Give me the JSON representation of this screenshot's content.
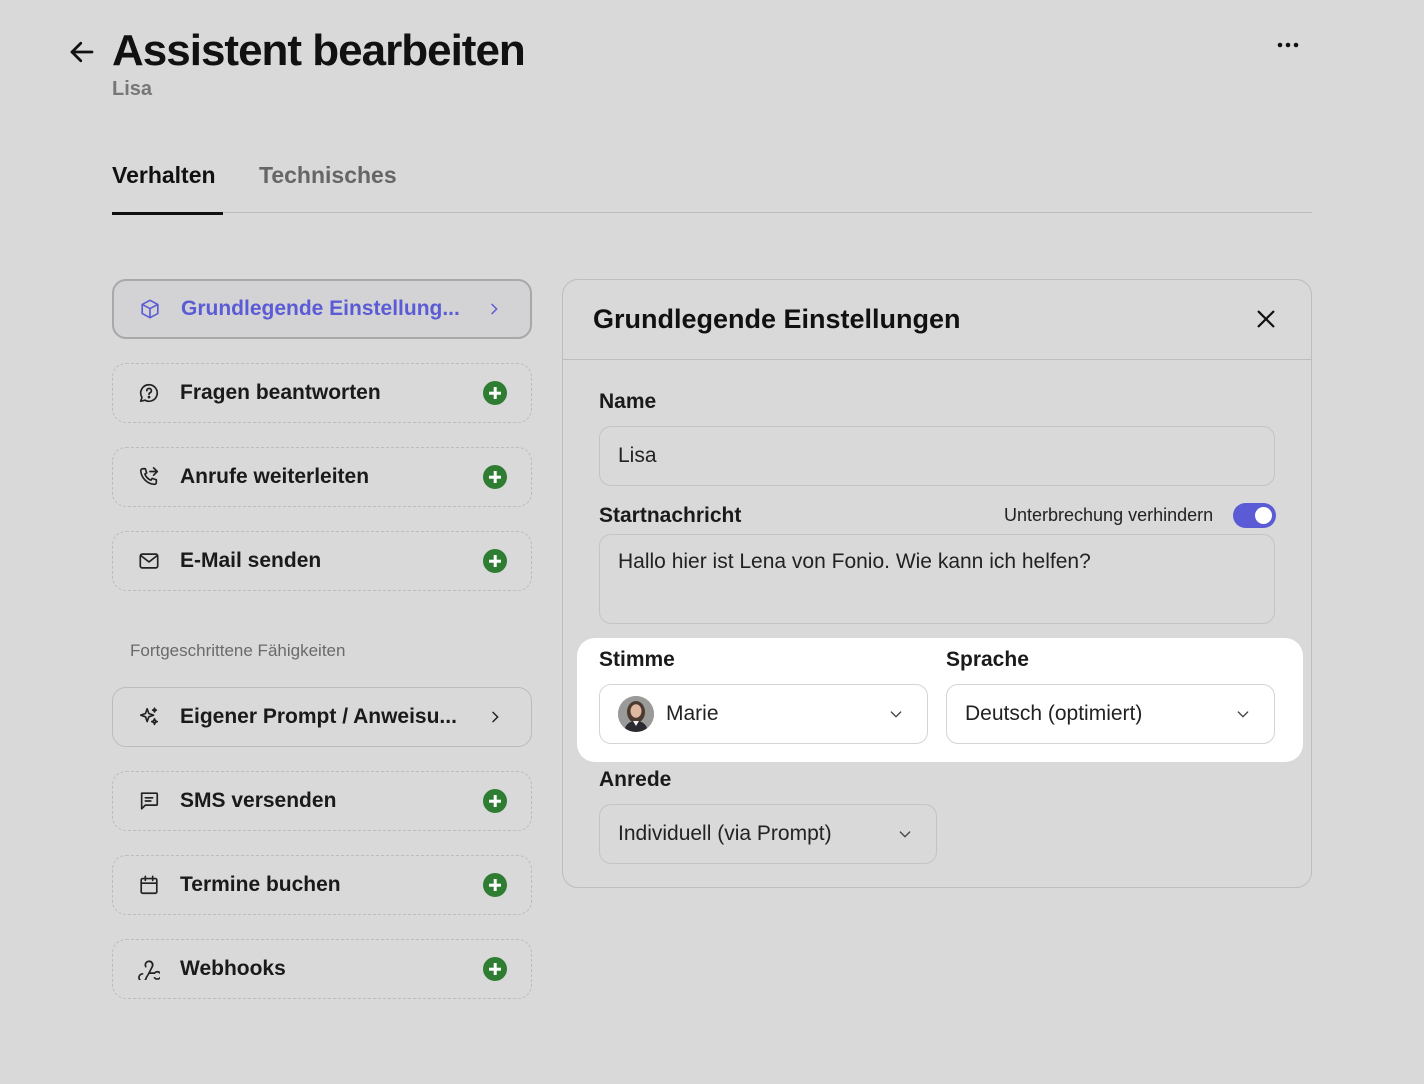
{
  "header": {
    "title": "Assistent bearbeiten",
    "subtitle": "Lisa",
    "back_icon": "arrow-left-icon",
    "more_icon": "more-horizontal-icon"
  },
  "tabs": [
    {
      "label": "Verhalten",
      "active": true
    },
    {
      "label": "Technisches",
      "active": false
    }
  ],
  "capabilities": {
    "basic": [
      {
        "label": "Grundlegende Einstellung...",
        "icon": "cube-icon",
        "action": "chevron-right-icon",
        "selected": true
      },
      {
        "label": "Fragen beantworten",
        "icon": "message-question-icon",
        "action": "plus-circle-icon"
      },
      {
        "label": "Anrufe weiterleiten",
        "icon": "phone-forward-icon",
        "action": "plus-circle-icon"
      },
      {
        "label": "E-Mail senden",
        "icon": "mail-icon",
        "action": "plus-circle-icon"
      }
    ],
    "advanced_title": "Fortgeschrittene Fähigkeiten",
    "advanced": [
      {
        "label": "Eigener Prompt / Anweisu...",
        "icon": "sparkles-icon",
        "action": "chevron-right-icon"
      },
      {
        "label": "SMS versenden",
        "icon": "message-square-icon",
        "action": "plus-circle-icon"
      },
      {
        "label": "Termine buchen",
        "icon": "calendar-icon",
        "action": "plus-circle-icon"
      },
      {
        "label": "Webhooks",
        "icon": "webhook-icon",
        "action": "plus-circle-icon"
      }
    ]
  },
  "panel": {
    "title": "Grundlegende Einstellungen",
    "name_label": "Name",
    "name_value": "Lisa",
    "start_label": "Startnachricht",
    "interrupt_label": "Unterbrechung verhindern",
    "interrupt_on": true,
    "start_value": "Hallo hier ist Lena von Fonio. Wie kann ich helfen?",
    "voice_label": "Stimme",
    "voice_value": "Marie",
    "language_label": "Sprache",
    "language_value": "Deutsch (optimiert)",
    "salutation_label": "Anrede",
    "salutation_value": "Individuell (via Prompt)"
  },
  "colors": {
    "accent": "#5b5bd6",
    "add_green": "#2e7d32",
    "background": "#d9d9d9"
  }
}
